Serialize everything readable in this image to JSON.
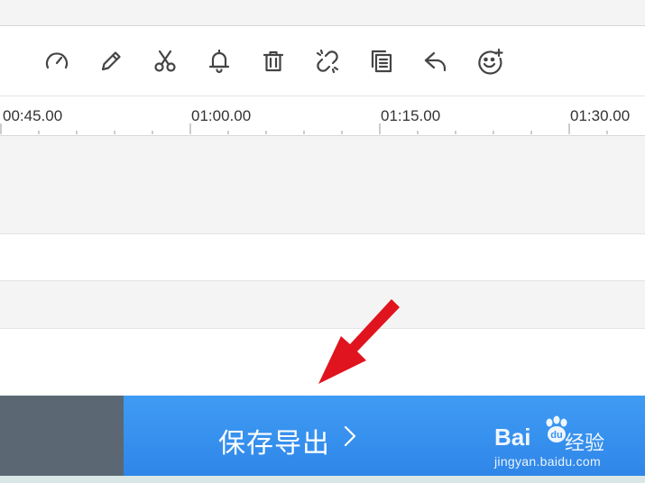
{
  "toolbar": {
    "tools": [
      {
        "name": "speed-icon"
      },
      {
        "name": "pencil-icon"
      },
      {
        "name": "scissors-icon"
      },
      {
        "name": "bell-icon"
      },
      {
        "name": "trash-icon"
      },
      {
        "name": "unlink-icon"
      },
      {
        "name": "copy-icon"
      },
      {
        "name": "undo-icon"
      },
      {
        "name": "emoji-add-icon"
      }
    ]
  },
  "ruler": {
    "labels": [
      "00:45.00",
      "01:00.00",
      "01:15.00",
      "01:30.00"
    ]
  },
  "bottom": {
    "export_label": "保存导出",
    "export_color": "#3a93f0",
    "side_color": "#5b6874"
  },
  "watermark": {
    "brand": "Bai",
    "brand_cn": "经验",
    "url": "jingyan.baidu.com"
  },
  "annotation": {
    "arrow_color": "#e0141e"
  }
}
